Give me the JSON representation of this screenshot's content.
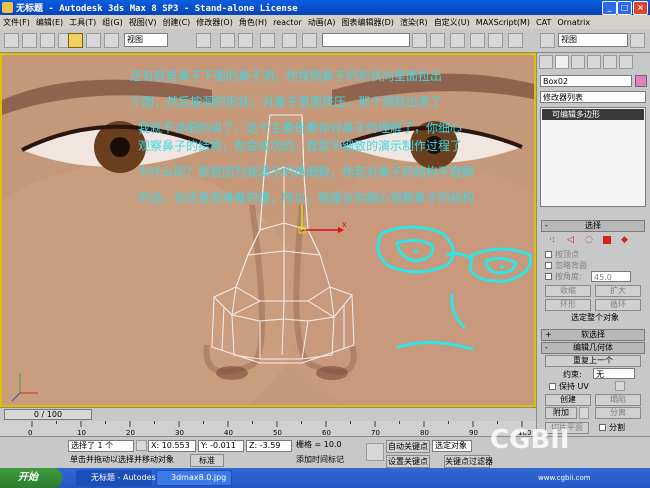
{
  "window": {
    "title": "无标题 - Autodesk 3ds Max 8 SP3 - Stand-alone License"
  },
  "menu": [
    "文件(F)",
    "编辑(E)",
    "工具(T)",
    "组(G)",
    "视图(V)",
    "创建(C)",
    "修改器(O)",
    "角色(H)",
    "reactor",
    "动画(A)",
    "图表编辑器(D)",
    "渲染(R)",
    "自定义(U)",
    "MAXScript(M)",
    "CAT",
    "Ornatrix"
  ],
  "toolbar": {
    "ref_coord": "视图",
    "named_sel": "",
    "view_sel": "视图"
  },
  "viewport": {
    "note_lines": [
      "还有就是鼻子下面的鼻子洞，你按照鼻子的形状向里面拉出",
      "个面，然后按洞的形状，对鼻子里面挤压，那个洞就出来了",
      "我就不详细的讲了，这个主要是看你对鼻子的理解了，你细心",
      "观察鼻子的结构，你会成功的，我就不细致的演示制作过程了",
      "为什么呢？那是因为我演示的再细致，你若对鼻子的结构不理解",
      "的话，你还是很难看的懂，所以，我建议你细心观察鼻子的结构"
    ]
  },
  "command_panel": {
    "object_name": "Box02",
    "modifier_list": "修改器列表",
    "stack_item": "可编辑多边形",
    "selection": {
      "title": "选择",
      "by_vertex": "按顶点",
      "ignore_backfacing": "忽略背面",
      "by_angle": "按角度:",
      "angle_value": "45.0",
      "shrink": "收缩",
      "grow": "扩大",
      "ring": "环形",
      "loop": "循环",
      "status": "选定整个对象"
    },
    "soft_selection": "软选择",
    "edit_geometry": {
      "title": "编辑几何体",
      "repeat_last": "重复上一个",
      "constraints_label": "约束:",
      "constraints_value": "无",
      "preserve_uvs": "保持 UV",
      "create": "创建",
      "collapse": "塌陷",
      "attach": "附加",
      "detach": "分离",
      "slice_plane": "切片平面",
      "split": "分割"
    }
  },
  "timeline": {
    "frame": "0 / 100",
    "ticks": [
      "0",
      "10",
      "20",
      "30",
      "40",
      "50",
      "60",
      "70",
      "80",
      "90",
      "100"
    ]
  },
  "status": {
    "selected": "选择了 1 个",
    "prompt": "单击并拖动以选择并移动对象",
    "x": "X: 10.553",
    "y": "Y: -0.011",
    "z": "Z: -3.59",
    "grid": "栅格 = 10.0",
    "add_time_tag": "添加时间标记",
    "auto_key": "自动关键点",
    "selected_obj": "选定对象",
    "set_key": "设置关键点",
    "key_filters": "关键点过滤器",
    "standard": "标准"
  },
  "taskbar": {
    "start": "开始",
    "task1": "无标题 - Autodes...",
    "task2": "3dmax8.0.jpg",
    "watermark": "CGBII",
    "watermark_sub": "www.cgbii.com"
  },
  "colors": {
    "note_text": "#3fd8e6",
    "viewport_border": "#e0c000",
    "title_bar": "#0a5ee0"
  }
}
